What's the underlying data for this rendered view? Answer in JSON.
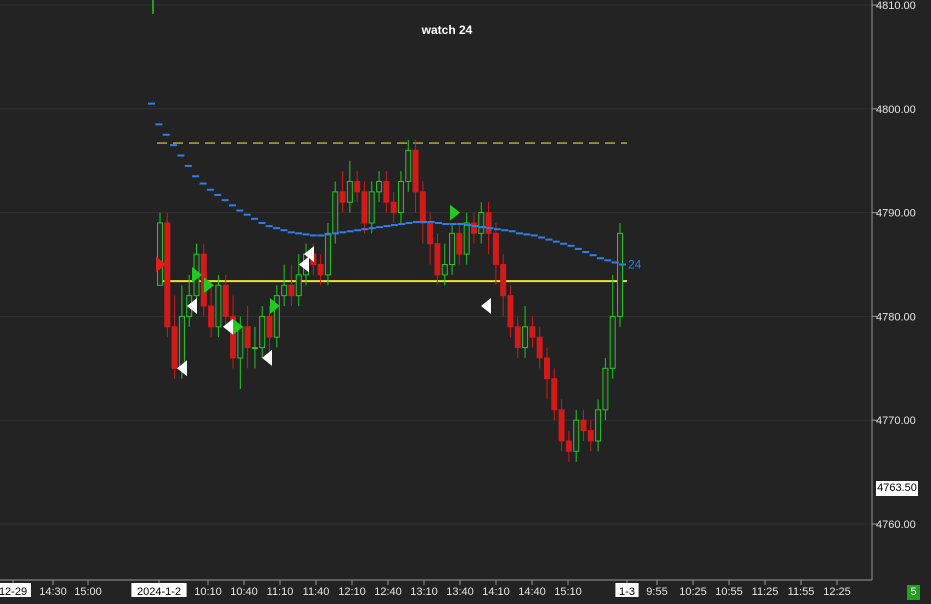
{
  "chart_data": {
    "type": "candlestick",
    "title": "watch 24",
    "y_axis": {
      "ticks": [
        "4810.00",
        "4800.00",
        "4790.00",
        "4780.00",
        "4770.00",
        "4760.00"
      ],
      "tick_values": [
        4810,
        4800,
        4790,
        4780,
        4770,
        4760
      ],
      "current_price_label": "4763.50",
      "range": [
        4755,
        4810.5
      ]
    },
    "x_axis": {
      "ticks": [
        "12-29",
        "14:30",
        "15:00",
        "2024-1-2",
        "10:10",
        "10:40",
        "11:10",
        "11:40",
        "12:10",
        "12:40",
        "13:10",
        "13:40",
        "14:10",
        "14:40",
        "15:10",
        "1-3",
        "9:55",
        "10:25",
        "10:55",
        "11:25",
        "11:55",
        "12:25"
      ]
    },
    "horizontal_lines": [
      {
        "name": "dashed-level",
        "value": 4796.7,
        "color": "#e8d23a",
        "style": "dashed"
      },
      {
        "name": "solid-level",
        "value": 4783.4,
        "color": "#f0e030",
        "style": "solid"
      }
    ],
    "moving_average": {
      "label": "24",
      "color": "#2f7fe6",
      "values": [
        4800.5,
        4798.5,
        4797.5,
        4796.5,
        4795.5,
        4794.5,
        4793.5,
        4792.8,
        4792.2,
        4791.7,
        4791.2,
        4790.7,
        4790.2,
        4789.8,
        4789.4,
        4789.0,
        4788.7,
        4788.5,
        4788.3,
        4788.1,
        4788.0,
        4787.9,
        4787.8,
        4787.8,
        4787.9,
        4788.0,
        4788.1,
        4788.2,
        4788.3,
        4788.4,
        4788.5,
        4788.6,
        4788.7,
        4788.8,
        4788.9,
        4789.0,
        4789.1,
        4789.1,
        4789.1,
        4789.0,
        4788.9,
        4788.9,
        4788.9,
        4788.8,
        4788.7,
        4788.6,
        4788.5,
        4788.4,
        4788.3,
        4788.2,
        4788.0,
        4787.9,
        4787.8,
        4787.6,
        4787.4,
        4787.2,
        4787.0,
        4786.8,
        4786.5,
        4786.2,
        4785.9,
        4785.6,
        4785.4,
        4785.2,
        4785.0
      ]
    },
    "candles": [
      [
        4783,
        4789,
        4785,
        4790
      ],
      [
        4789,
        4779,
        4778,
        4790
      ],
      [
        4779,
        4775,
        4774,
        4782
      ],
      [
        4775,
        4780,
        4774,
        4783
      ],
      [
        4780,
        4782,
        4779,
        4784
      ],
      [
        4782,
        4786,
        4781,
        4787
      ],
      [
        4786,
        4781,
        4780,
        4787
      ],
      [
        4781,
        4779,
        4778,
        4783
      ],
      [
        4779,
        4783,
        4778,
        4784
      ],
      [
        4783,
        4780,
        4779,
        4784
      ],
      [
        4780,
        4776,
        4775,
        4782
      ],
      [
        4776,
        4779,
        4773,
        4780
      ],
      [
        4779,
        4777,
        4775,
        4781
      ],
      [
        4777,
        4777,
        4775,
        4779
      ],
      [
        4777,
        4780,
        4776,
        4781
      ],
      [
        4780,
        4778,
        4776,
        4781
      ],
      [
        4778,
        4782,
        4777,
        4783
      ],
      [
        4782,
        4783,
        4781,
        4785
      ],
      [
        4783,
        4782,
        4781,
        4785
      ],
      [
        4782,
        4784,
        4781,
        4786
      ],
      [
        4784,
        4786,
        4783,
        4787
      ],
      [
        4786,
        4785,
        4784,
        4787
      ],
      [
        4785,
        4784,
        4783,
        4786
      ],
      [
        4784,
        4788,
        4783,
        4789
      ],
      [
        4788,
        4792,
        4787,
        4793
      ],
      [
        4792,
        4791,
        4790,
        4794
      ],
      [
        4791,
        4793,
        4790,
        4795
      ],
      [
        4793,
        4792,
        4791,
        4794
      ],
      [
        4792,
        4789,
        4788,
        4793
      ],
      [
        4789,
        4792,
        4788,
        4793
      ],
      [
        4792,
        4793,
        4791,
        4794
      ],
      [
        4793,
        4791,
        4790,
        4794
      ],
      [
        4791,
        4790,
        4789,
        4792
      ],
      [
        4790,
        4793,
        4789,
        4794
      ],
      [
        4793,
        4796,
        4792,
        4797
      ],
      [
        4796,
        4792,
        4790,
        4797
      ],
      [
        4792,
        4789,
        4787,
        4793
      ],
      [
        4789,
        4787,
        4785,
        4790
      ],
      [
        4787,
        4784,
        4783,
        4788
      ],
      [
        4784,
        4785,
        4783,
        4787
      ],
      [
        4785,
        4788,
        4784,
        4789
      ],
      [
        4788,
        4786,
        4785,
        4789
      ],
      [
        4786,
        4789,
        4785,
        4790
      ],
      [
        4789,
        4788,
        4787,
        4790
      ],
      [
        4788,
        4790,
        4787,
        4791
      ],
      [
        4790,
        4788,
        4786,
        4791
      ],
      [
        4788,
        4785,
        4783,
        4789
      ],
      [
        4785,
        4782,
        4780,
        4786
      ],
      [
        4782,
        4779,
        4778,
        4783
      ],
      [
        4779,
        4777,
        4776,
        4780
      ],
      [
        4777,
        4779,
        4776,
        4781
      ],
      [
        4779,
        4778,
        4777,
        4780
      ],
      [
        4778,
        4776,
        4775,
        4779
      ],
      [
        4776,
        4774,
        4772,
        4777
      ],
      [
        4774,
        4771,
        4770,
        4775
      ],
      [
        4771,
        4768,
        4767,
        4772
      ],
      [
        4768,
        4767,
        4766,
        4769
      ],
      [
        4767,
        4770,
        4766,
        4771
      ],
      [
        4770,
        4769,
        4768,
        4771
      ],
      [
        4769,
        4768,
        4767,
        4770
      ],
      [
        4768,
        4771,
        4767,
        4772
      ],
      [
        4771,
        4775,
        4770,
        4776
      ],
      [
        4775,
        4780,
        4774,
        4784
      ],
      [
        4780,
        4788,
        4779,
        4789
      ]
    ]
  }
}
